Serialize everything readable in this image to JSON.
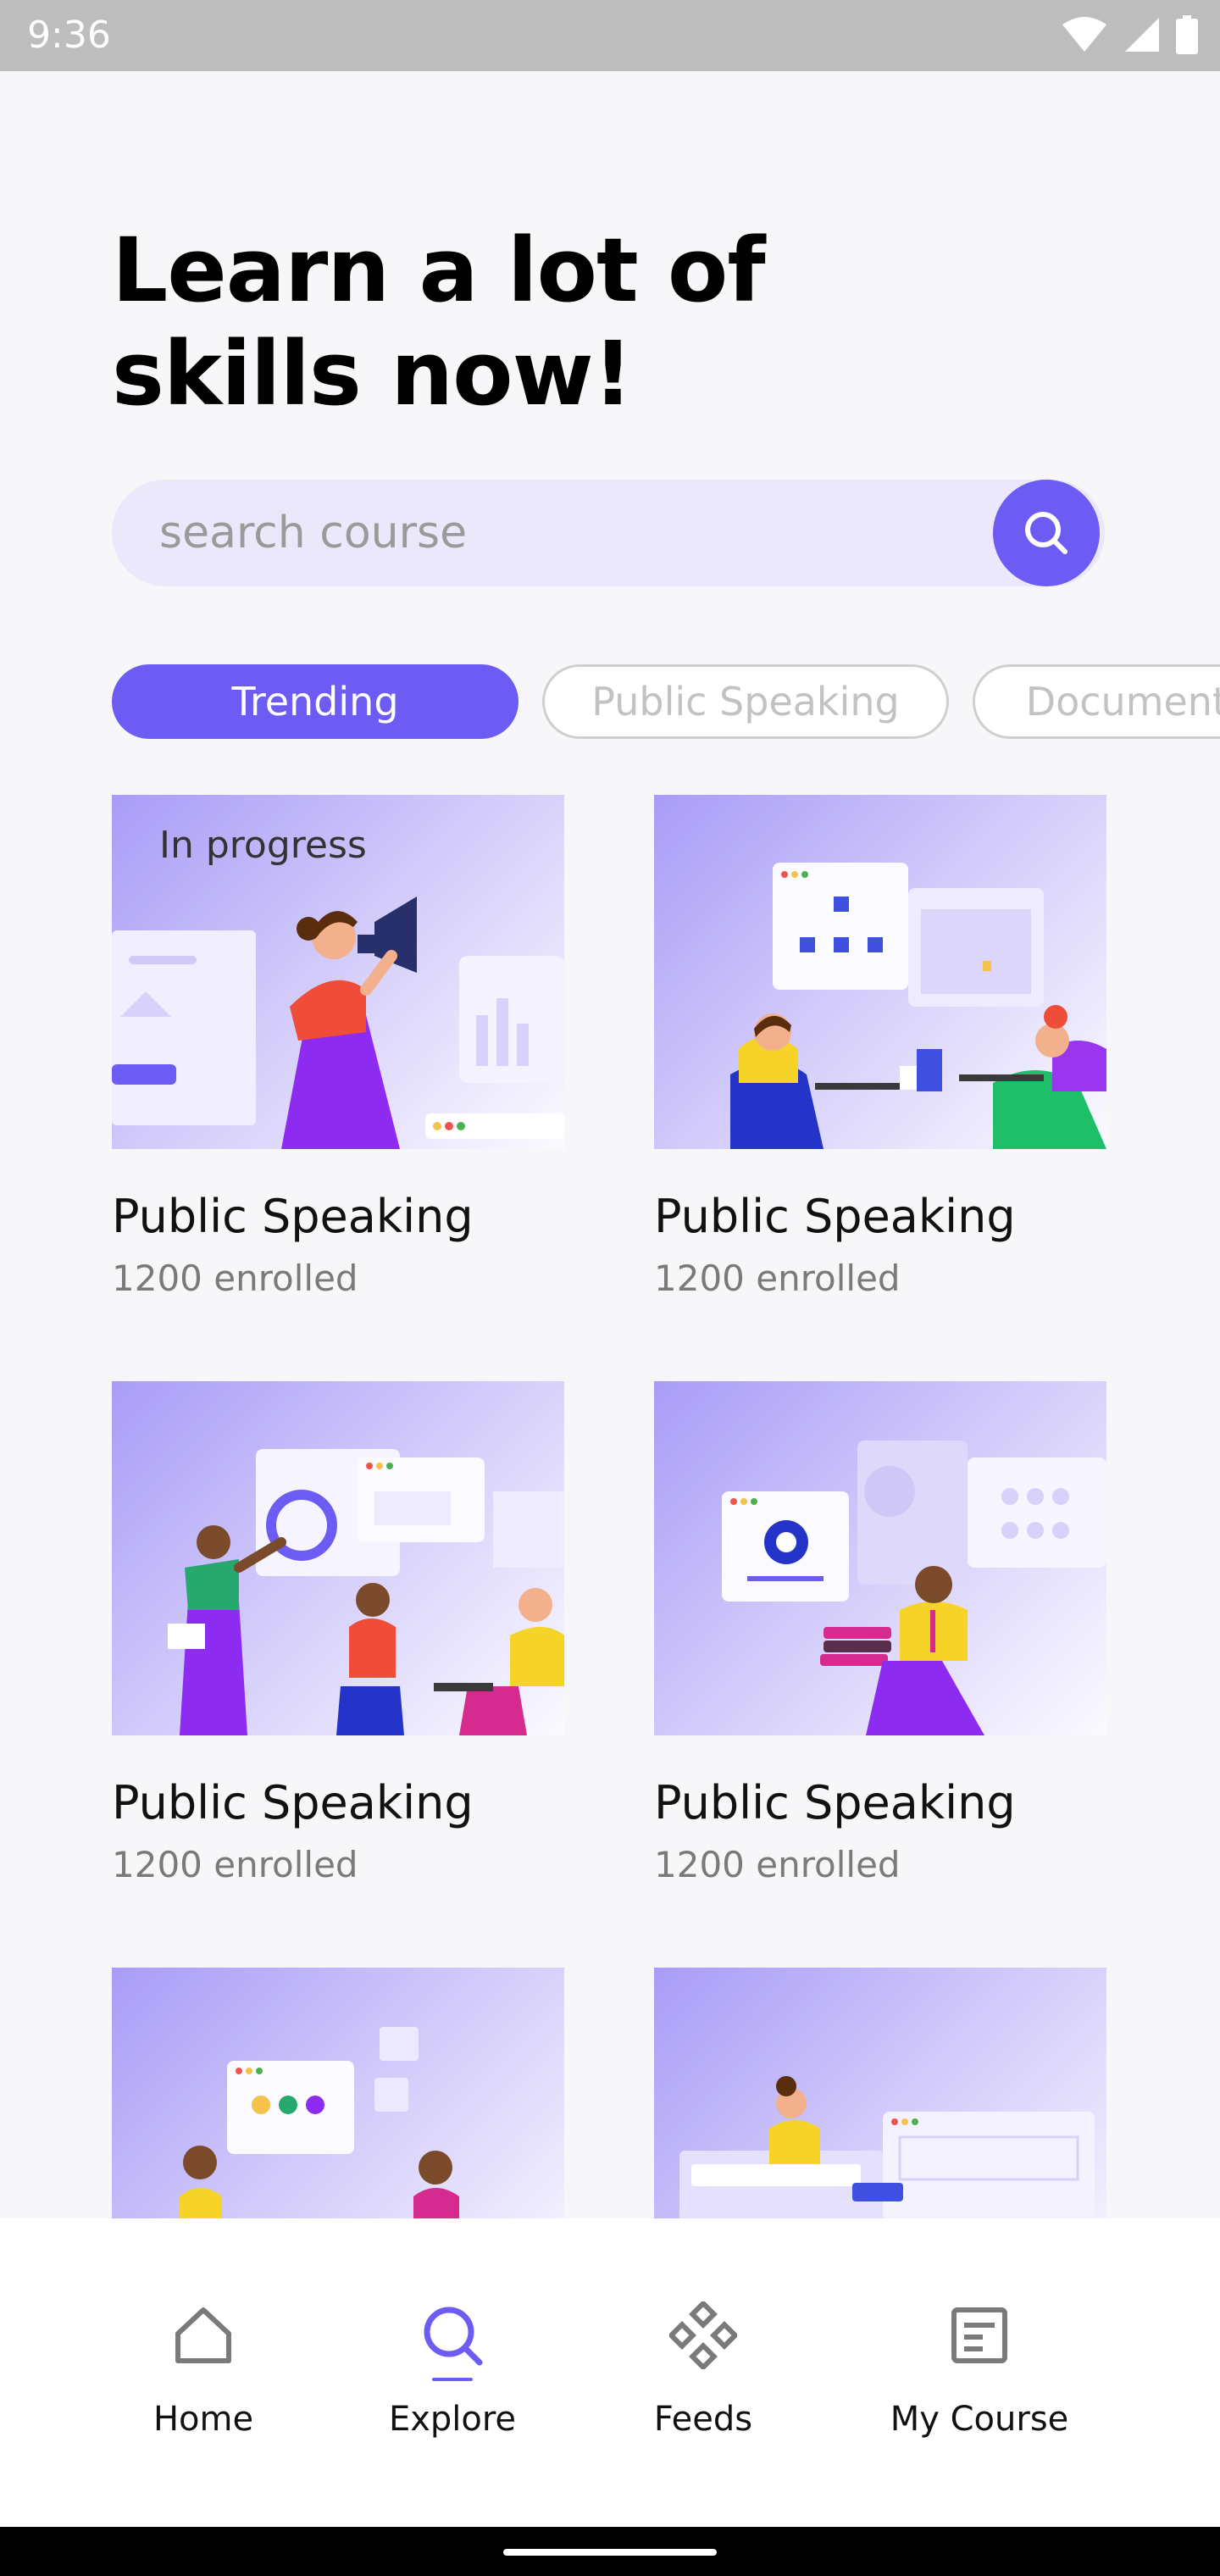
{
  "status_bar": {
    "time": "9:36"
  },
  "header": {
    "title_line1": "Learn a lot of",
    "title_line2": "skills now!"
  },
  "search": {
    "placeholder": "search course"
  },
  "categories": [
    {
      "label": "Trending",
      "active": true
    },
    {
      "label": "Public Speaking",
      "active": false
    },
    {
      "label": "Documentation",
      "active": false
    }
  ],
  "courses": [
    {
      "title": "Public Speaking",
      "subtitle": "1200 enrolled",
      "badge": "In progress"
    },
    {
      "title": "Public Speaking",
      "subtitle": "1200 enrolled"
    },
    {
      "title": "Public Speaking",
      "subtitle": "1200 enrolled"
    },
    {
      "title": "Public Speaking",
      "subtitle": "1200 enrolled"
    }
  ],
  "bottom_nav": {
    "items": [
      {
        "label": "Home",
        "icon": "home-icon"
      },
      {
        "label": "Explore",
        "icon": "search-icon",
        "active": true
      },
      {
        "label": "Feeds",
        "icon": "feeds-icon"
      },
      {
        "label": "My Course",
        "icon": "course-icon"
      }
    ]
  },
  "colors": {
    "accent": "#6d5cf4",
    "accent_light": "#ebe8fb",
    "status_bar": "#bdbdbd"
  }
}
